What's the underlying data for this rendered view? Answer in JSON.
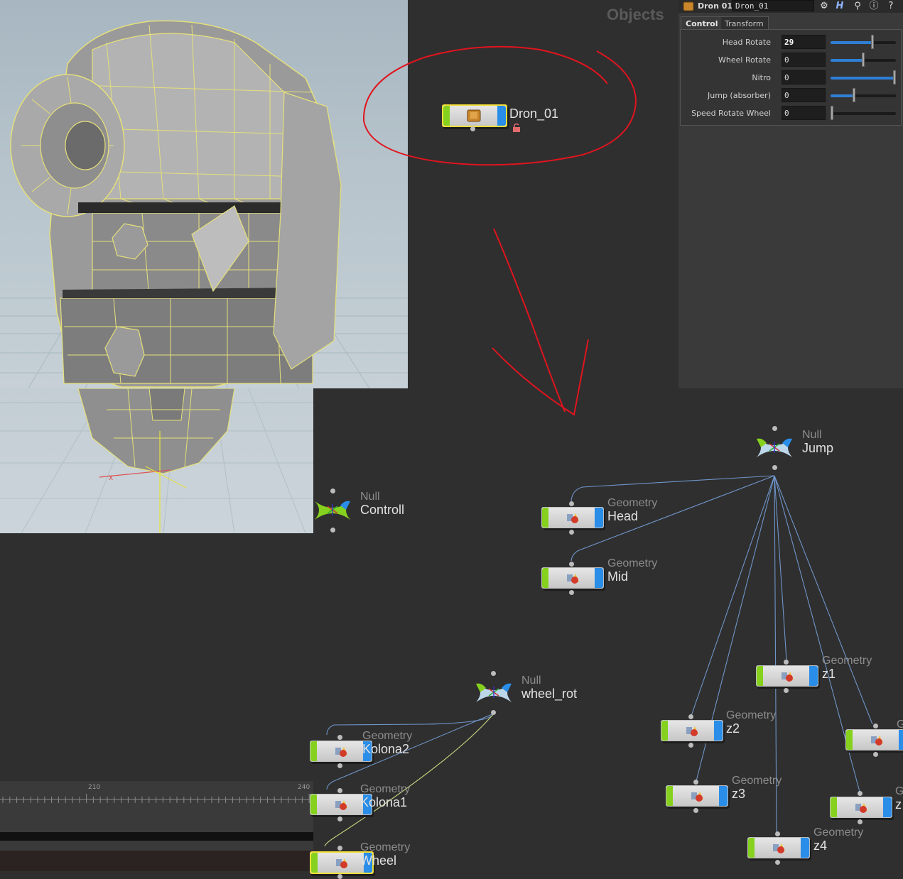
{
  "network": {
    "title": "Objects",
    "top_node": {
      "name": "Dron_01"
    },
    "nodes": {
      "jump": {
        "type": "Null",
        "name": "Jump"
      },
      "controll": {
        "type": "Null",
        "name": "Controll"
      },
      "wheel_rot": {
        "type": "Null",
        "name": "wheel_rot"
      },
      "head": {
        "type": "Geometry",
        "name": "Head"
      },
      "mid": {
        "type": "Geometry",
        "name": "Mid"
      },
      "z1": {
        "type": "Geometry",
        "name": "z1"
      },
      "z2": {
        "type": "Geometry",
        "name": "z2"
      },
      "z3": {
        "type": "Geometry",
        "name": "z3"
      },
      "z4": {
        "type": "Geometry",
        "name": "z4"
      },
      "z5": {
        "type": "Ge",
        "name": ""
      },
      "z6": {
        "type": "G",
        "name": "z"
      },
      "kolona2": {
        "type": "Geometry",
        "name": "Kolona2"
      },
      "kolona1": {
        "type": "Geometry",
        "name": "Kolona1"
      },
      "wheel": {
        "type": "Geometry",
        "name": "Wheel"
      }
    }
  },
  "panel": {
    "node_name": "Dron 01",
    "node_field": "Dron_01",
    "tabs": [
      "Control",
      "Transform"
    ],
    "active_tab": "Control",
    "params": [
      {
        "label": "Head Rotate",
        "value": "29",
        "level": 0.64
      },
      {
        "label": "Wheel Rotate",
        "value": "0",
        "level": 0.5
      },
      {
        "label": "Nitro",
        "value": "0",
        "level": 1.0
      },
      {
        "label": "Jump (absorber)",
        "value": "0",
        "level": 0.36
      },
      {
        "label": "Speed Rotate Wheel",
        "value": "0",
        "level": 0.0
      }
    ],
    "icons": [
      "gear-icon",
      "houdini-h-icon",
      "search-icon",
      "info-icon",
      "help-icon"
    ]
  },
  "timeline": {
    "ticks": [
      "210",
      "240"
    ]
  },
  "viewport": {
    "axis_label": "X"
  },
  "colors": {
    "annotation": "#e0141e",
    "wire": "#6f95c9",
    "wire_selected": "#c7d27e",
    "node_green": "#86d11e",
    "node_blue": "#2a8de8"
  }
}
